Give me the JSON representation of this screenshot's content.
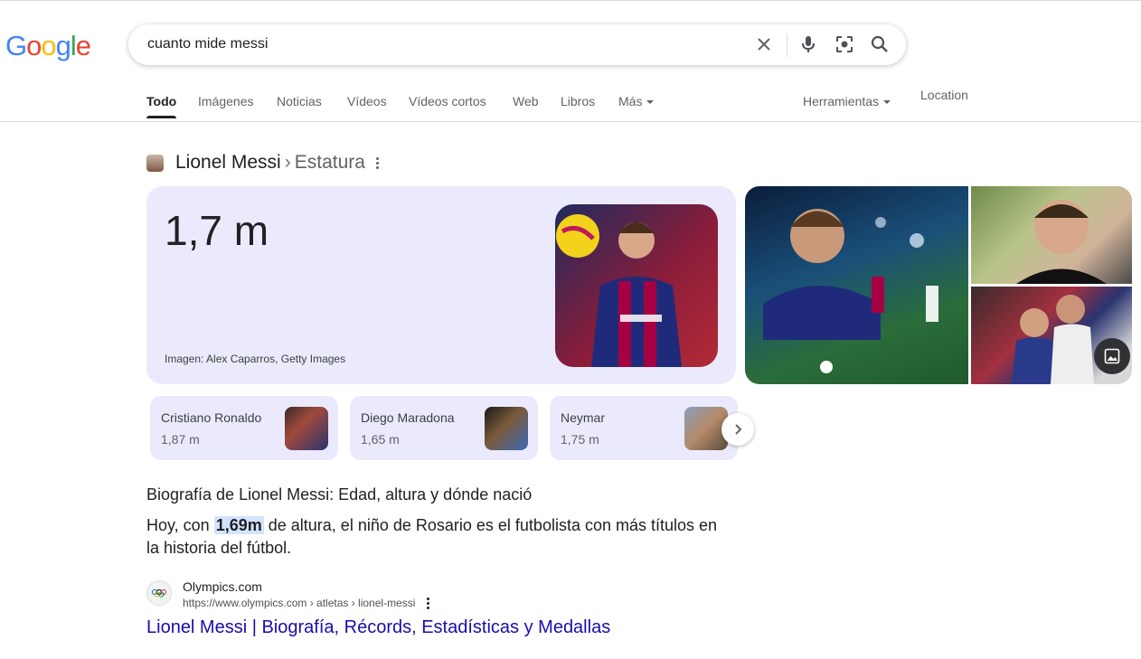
{
  "logo": {
    "letters": [
      "G",
      "o",
      "o",
      "g",
      "l",
      "e"
    ],
    "colors": [
      "#4285f4",
      "#ea4335",
      "#fbbc05",
      "#4285f4",
      "#34a853",
      "#ea4335"
    ]
  },
  "search": {
    "query": "cuanto mide messi",
    "icons": [
      "close-icon",
      "mic-icon",
      "lens-icon",
      "search-icon"
    ]
  },
  "tabs": [
    {
      "label": "Todo",
      "active": true
    },
    {
      "label": "Imágenes"
    },
    {
      "label": "Noticias"
    },
    {
      "label": "Vídeos"
    },
    {
      "label": "Vídeos cortos"
    },
    {
      "label": "Web"
    },
    {
      "label": "Libros"
    },
    {
      "label": "Más"
    }
  ],
  "tools_label": "Herramientas",
  "location_label": "Location",
  "entity": {
    "name": "Lionel Messi",
    "separator": "›",
    "attribute": "Estatura"
  },
  "answer": {
    "value": "1,7 m",
    "credit": "Imagen: Alex Caparros, Getty Images"
  },
  "related": [
    {
      "name": "Cristiano Ronaldo",
      "value": "1,87 m"
    },
    {
      "name": "Diego Maradona",
      "value": "1,65 m"
    },
    {
      "name": "Neymar",
      "value": "1,75 m"
    }
  ],
  "snippet": {
    "title": "Biografía de Lionel Messi: Edad, altura y dónde nació",
    "text_before": "Hoy, con ",
    "highlight": "1,69m",
    "text_after": " de altura, el niño de Rosario es el futbolista con más títulos en la historia del fútbol."
  },
  "source": {
    "site": "Olympics.com",
    "url": "https://www.olympics.com › atletas › lionel-messi",
    "link_title": "Lionel Messi | Biografía, Récords, Estadísticas y Medallas"
  }
}
